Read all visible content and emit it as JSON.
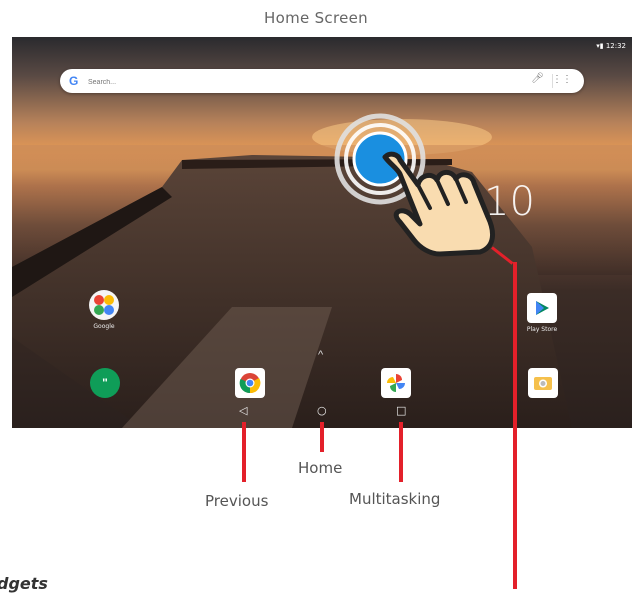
{
  "page": {
    "title": "Home Screen"
  },
  "statusbar": {
    "text": "▾▮ 12:32"
  },
  "search": {
    "g": "G",
    "placeholder": "Search..."
  },
  "clock": {
    "text": "10"
  },
  "apps": [
    {
      "label": "Google",
      "icon": "google-folder-icon"
    },
    {
      "label": "Play Store",
      "icon": "play-store-icon"
    }
  ],
  "dock": [
    "hangouts-icon",
    "chrome-icon",
    "photos-icon",
    "camera-icon"
  ],
  "navbar": {
    "back": "◁",
    "home": "○",
    "recent": "□"
  },
  "callouts": {
    "home": "Home",
    "previous": "Previous",
    "multitasking": "Multitasking"
  },
  "footer": {
    "text": "dgets"
  },
  "colors": {
    "accent": "#e3202a"
  }
}
